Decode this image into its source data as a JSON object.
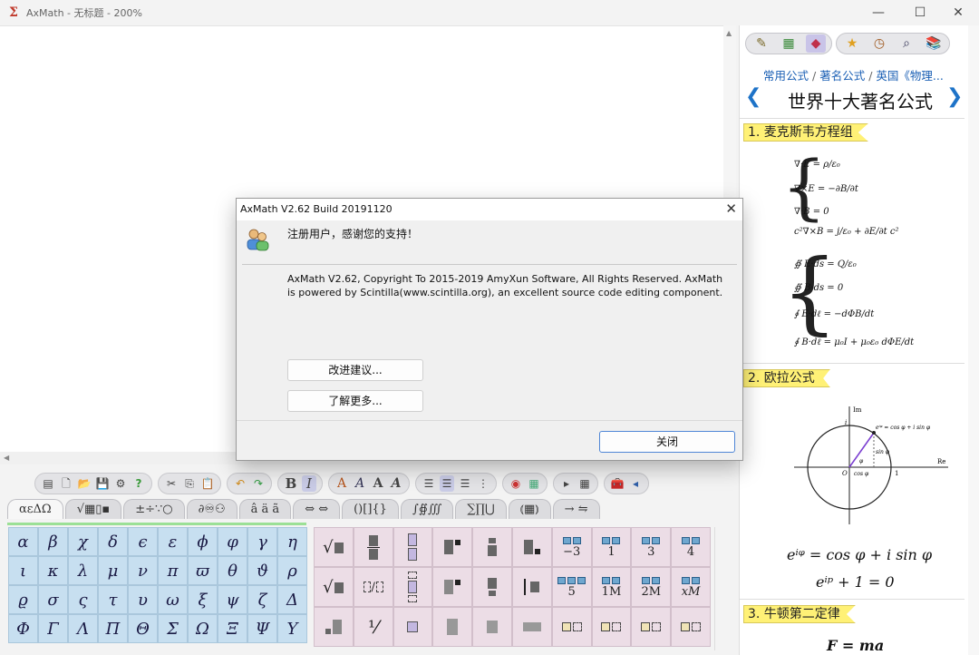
{
  "window": {
    "title": "AxMath - 无标题 - 200%",
    "logo_glyph": "Σ",
    "minimize": "—",
    "maximize": "☐",
    "close": "✕"
  },
  "toolbar": {
    "bold": "B",
    "italic": "I",
    "font_a": [
      "A",
      "A",
      "A",
      "A"
    ]
  },
  "symbol_tabs": [
    "αεΔΩ",
    "√▦▯▪",
    "±÷∵○",
    "∂♾⚇",
    "â ä ã",
    "⇔ ⇔",
    "()[]{}",
    "∫∯∭",
    "∑∏⋃",
    "⦅▦⦆",
    "→ ⇋"
  ],
  "greek_symbols": [
    "α",
    "β",
    "χ",
    "δ",
    "ϵ",
    "ε",
    "ϕ",
    "φ",
    "γ",
    "η",
    "ι",
    "κ",
    "λ",
    "μ",
    "ν",
    "π",
    "ϖ",
    "θ",
    "ϑ",
    "ρ",
    "ϱ",
    "σ",
    "ς",
    "τ",
    "υ",
    "ω",
    "ξ",
    "ψ",
    "ζ",
    "Δ",
    "Φ",
    "Γ",
    "Λ",
    "Π",
    "Θ",
    "Σ",
    "Ω",
    "Ξ",
    "Ψ",
    "Υ"
  ],
  "template_labels": {
    "r1c7": "−3",
    "r1c8": "1",
    "r1c9": "3",
    "r1c10": "4",
    "r2c7": "5",
    "r2c8": "1M",
    "r2c9": "2M",
    "r2c10": "xM"
  },
  "right_panel": {
    "breadcrumb": [
      "常用公式",
      "著名公式",
      "英国《物理..."
    ],
    "breadcrumb_sep": "/",
    "prev": "❮",
    "next": "❯",
    "title": "世界十大著名公式",
    "sections": [
      {
        "label": "1. 麦克斯韦方程组"
      },
      {
        "label": "2. 欧拉公式"
      },
      {
        "label": "3. 牛顿第二定律"
      }
    ],
    "maxwell_differential": [
      "∇·E = ρ/ε₀",
      "∇×E = −∂B/∂t",
      "∇·B = 0",
      "c²∇×B = j/ε₀ + ∂E/∂t c²"
    ],
    "maxwell_integral": [
      "∯ E·ds = Q/ε₀",
      "∯ B·ds = 0",
      "∮ E·dℓ = −dΦB/dt",
      "∮ B·dℓ = μ₀I + μ₀ε₀ dΦE/dt"
    ],
    "euler_diagram": {
      "im": "Im",
      "re": "Re",
      "one_top": "i",
      "one_right": "1",
      "origin": "O",
      "point": "eⁱᵠ = cos φ + i sin φ",
      "sin": "sin φ",
      "cos": "cos φ",
      "phi": "φ"
    },
    "euler_formula_1": "eⁱᵠ = cos φ + i sin φ",
    "euler_formula_2": "eⁱᵖ + 1 = 0",
    "newton_formula": "F = ma"
  },
  "dialog": {
    "title": "AxMath V2.62 Build 20191120",
    "close": "✕",
    "message": "注册用户，感谢您的支持！",
    "copyright": "AxMath V2.62, Copyright To 2015-2019 AmyXun Software, All Rights Reserved. AxMath is powered by Scintilla(www.scintilla.org), an excellent source code editing component.",
    "suggest_btn": "改进建议...",
    "more_btn": "了解更多...",
    "close_btn": "关闭"
  }
}
